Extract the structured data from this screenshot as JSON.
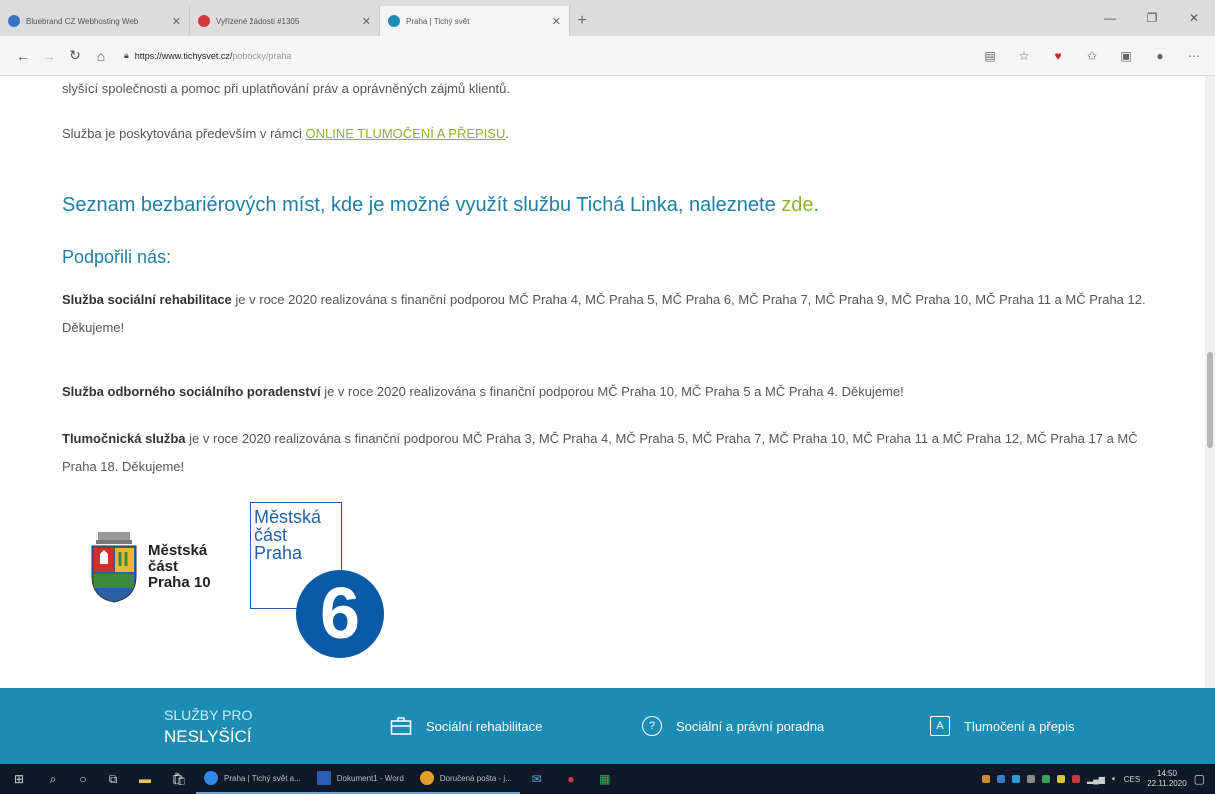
{
  "browser": {
    "tabs": [
      {
        "title": "Bluebrand CZ Webhosting Web",
        "fav_color": "#3b74c4"
      },
      {
        "title": "Vyřízené žádosti #1305",
        "fav_color": "#d23a3a"
      },
      {
        "title": "Praha | Tichý svět",
        "fav_color": "#1d8cb5"
      }
    ],
    "url_host": "https://www.tichysvet.cz/",
    "url_path": "pobocky/praha"
  },
  "page": {
    "intro_line": "slyšící společnosti a pomoc při uplatňování práv a oprávněných zájmů klientů.",
    "service_text": "Služba je poskytována především v rámci ",
    "service_link": "ONLINE TLUMOČENÍ A PŘEPISU",
    "service_end": ".",
    "places_text": "Seznam bezbariérových míst, kde je možné využít službu Tichá Linka, naleznete ",
    "places_link": "zde",
    "places_end": ".",
    "supported_heading": "Podpořili nás:",
    "p1_bold": "Služba sociální rehabilitace",
    "p1_text": " je v roce 2020 realizována s finanční podporou MČ Praha 4, MČ Praha 5, MČ Praha 6, MČ Praha 7, MČ Praha 9, MČ Praha 10, MČ Praha 11 a MČ Praha 12. Děkujeme!",
    "p2_bold": "Služba odborného sociálního poradenství",
    "p2_text": " je v roce 2020 realizována s finanční podporou MČ Praha 10, MČ Praha 5 a MČ Praha 4. Děkujeme!",
    "p3_bold": "Tlumočnická služba",
    "p3_text": " je v roce 2020 realizována s finanční podporou MČ Praha 3, MČ Praha 4, MČ Praha 5, MČ Praha 7, MČ Praha 10, MČ Praha 11 a MČ Praha 12, MČ Praha 17 a MČ Praha 18. Děkujeme!",
    "logo10": {
      "l1": "Městská",
      "l2": "část",
      "l3": "Praha 10"
    },
    "logo6": {
      "l1": "Městská",
      "l2": "část",
      "l3": "Praha",
      "number": "6"
    }
  },
  "footer": {
    "brand_l1": "SLUŽBY PRO",
    "brand_l2": "NESLYŠÍCÍ",
    "items": [
      {
        "label": "Sociální rehabilitace"
      },
      {
        "label": "Sociální a právní poradna",
        "icon": "?"
      },
      {
        "label": "Tlumočení a přepis",
        "icon": "A"
      }
    ]
  },
  "taskbar": {
    "apps": [
      {
        "label": "Praha | Tichý svět a..."
      },
      {
        "label": "Dokument1 - Word"
      },
      {
        "label": "Doručená pošta - j..."
      }
    ],
    "lang": "CES",
    "time": "14:50",
    "date": "22.11.2020"
  },
  "colors": {
    "accent": "#1d8cb5",
    "heading_blue": "#1f7ea3",
    "link_green": "#8ab32e"
  }
}
